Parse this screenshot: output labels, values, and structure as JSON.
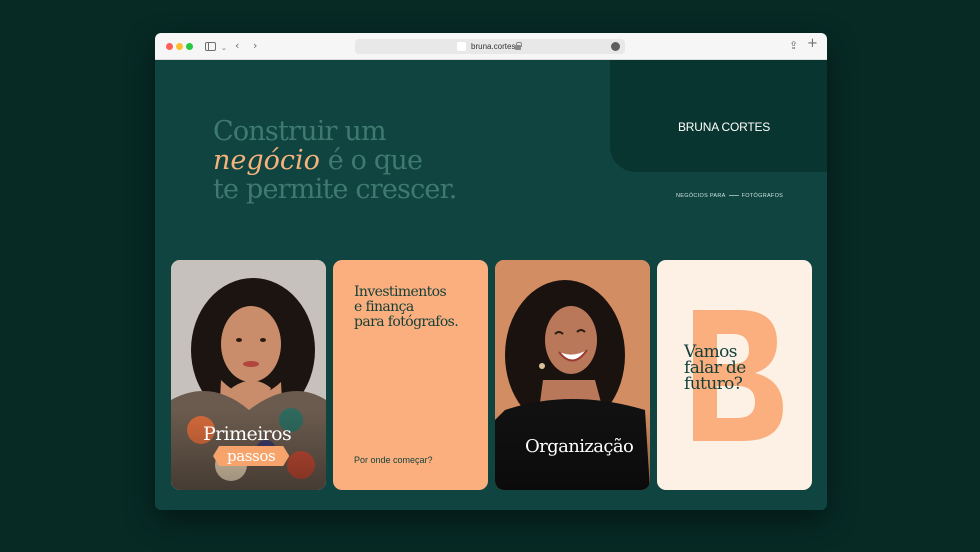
{
  "browser": {
    "url": "bruna.cortes",
    "controls": {
      "back": "‹",
      "forward": "›",
      "sidebar_chevron": "⌄",
      "share": "⇪",
      "new_tab": "+",
      "more": "•••"
    }
  },
  "hero": {
    "line1": "Construir um",
    "line2_script": "negócio",
    "line2_rest": " é o que",
    "line3": "te permite crescer."
  },
  "brand": {
    "name": "BRUNA CORTES",
    "tagline_left": "NEGÓCIOS PARA",
    "tagline_right": "FOTÓGRAFOS"
  },
  "cards": [
    {
      "title": "Primeiros",
      "pill": "passos"
    },
    {
      "lines": [
        "Investimentos",
        "e finança",
        "para fotógrafos."
      ],
      "link": "Por onde começar?"
    },
    {
      "title": "Organização"
    },
    {
      "lines": [
        "Vamos",
        "falar de",
        "futuro?"
      ],
      "letter": "B"
    }
  ],
  "colors": {
    "page_bg": "#0f4440",
    "panel": "#093530",
    "accent_peach": "#fbaf7e",
    "cream": "#fdf1e5",
    "dark_text": "#123f3a"
  }
}
